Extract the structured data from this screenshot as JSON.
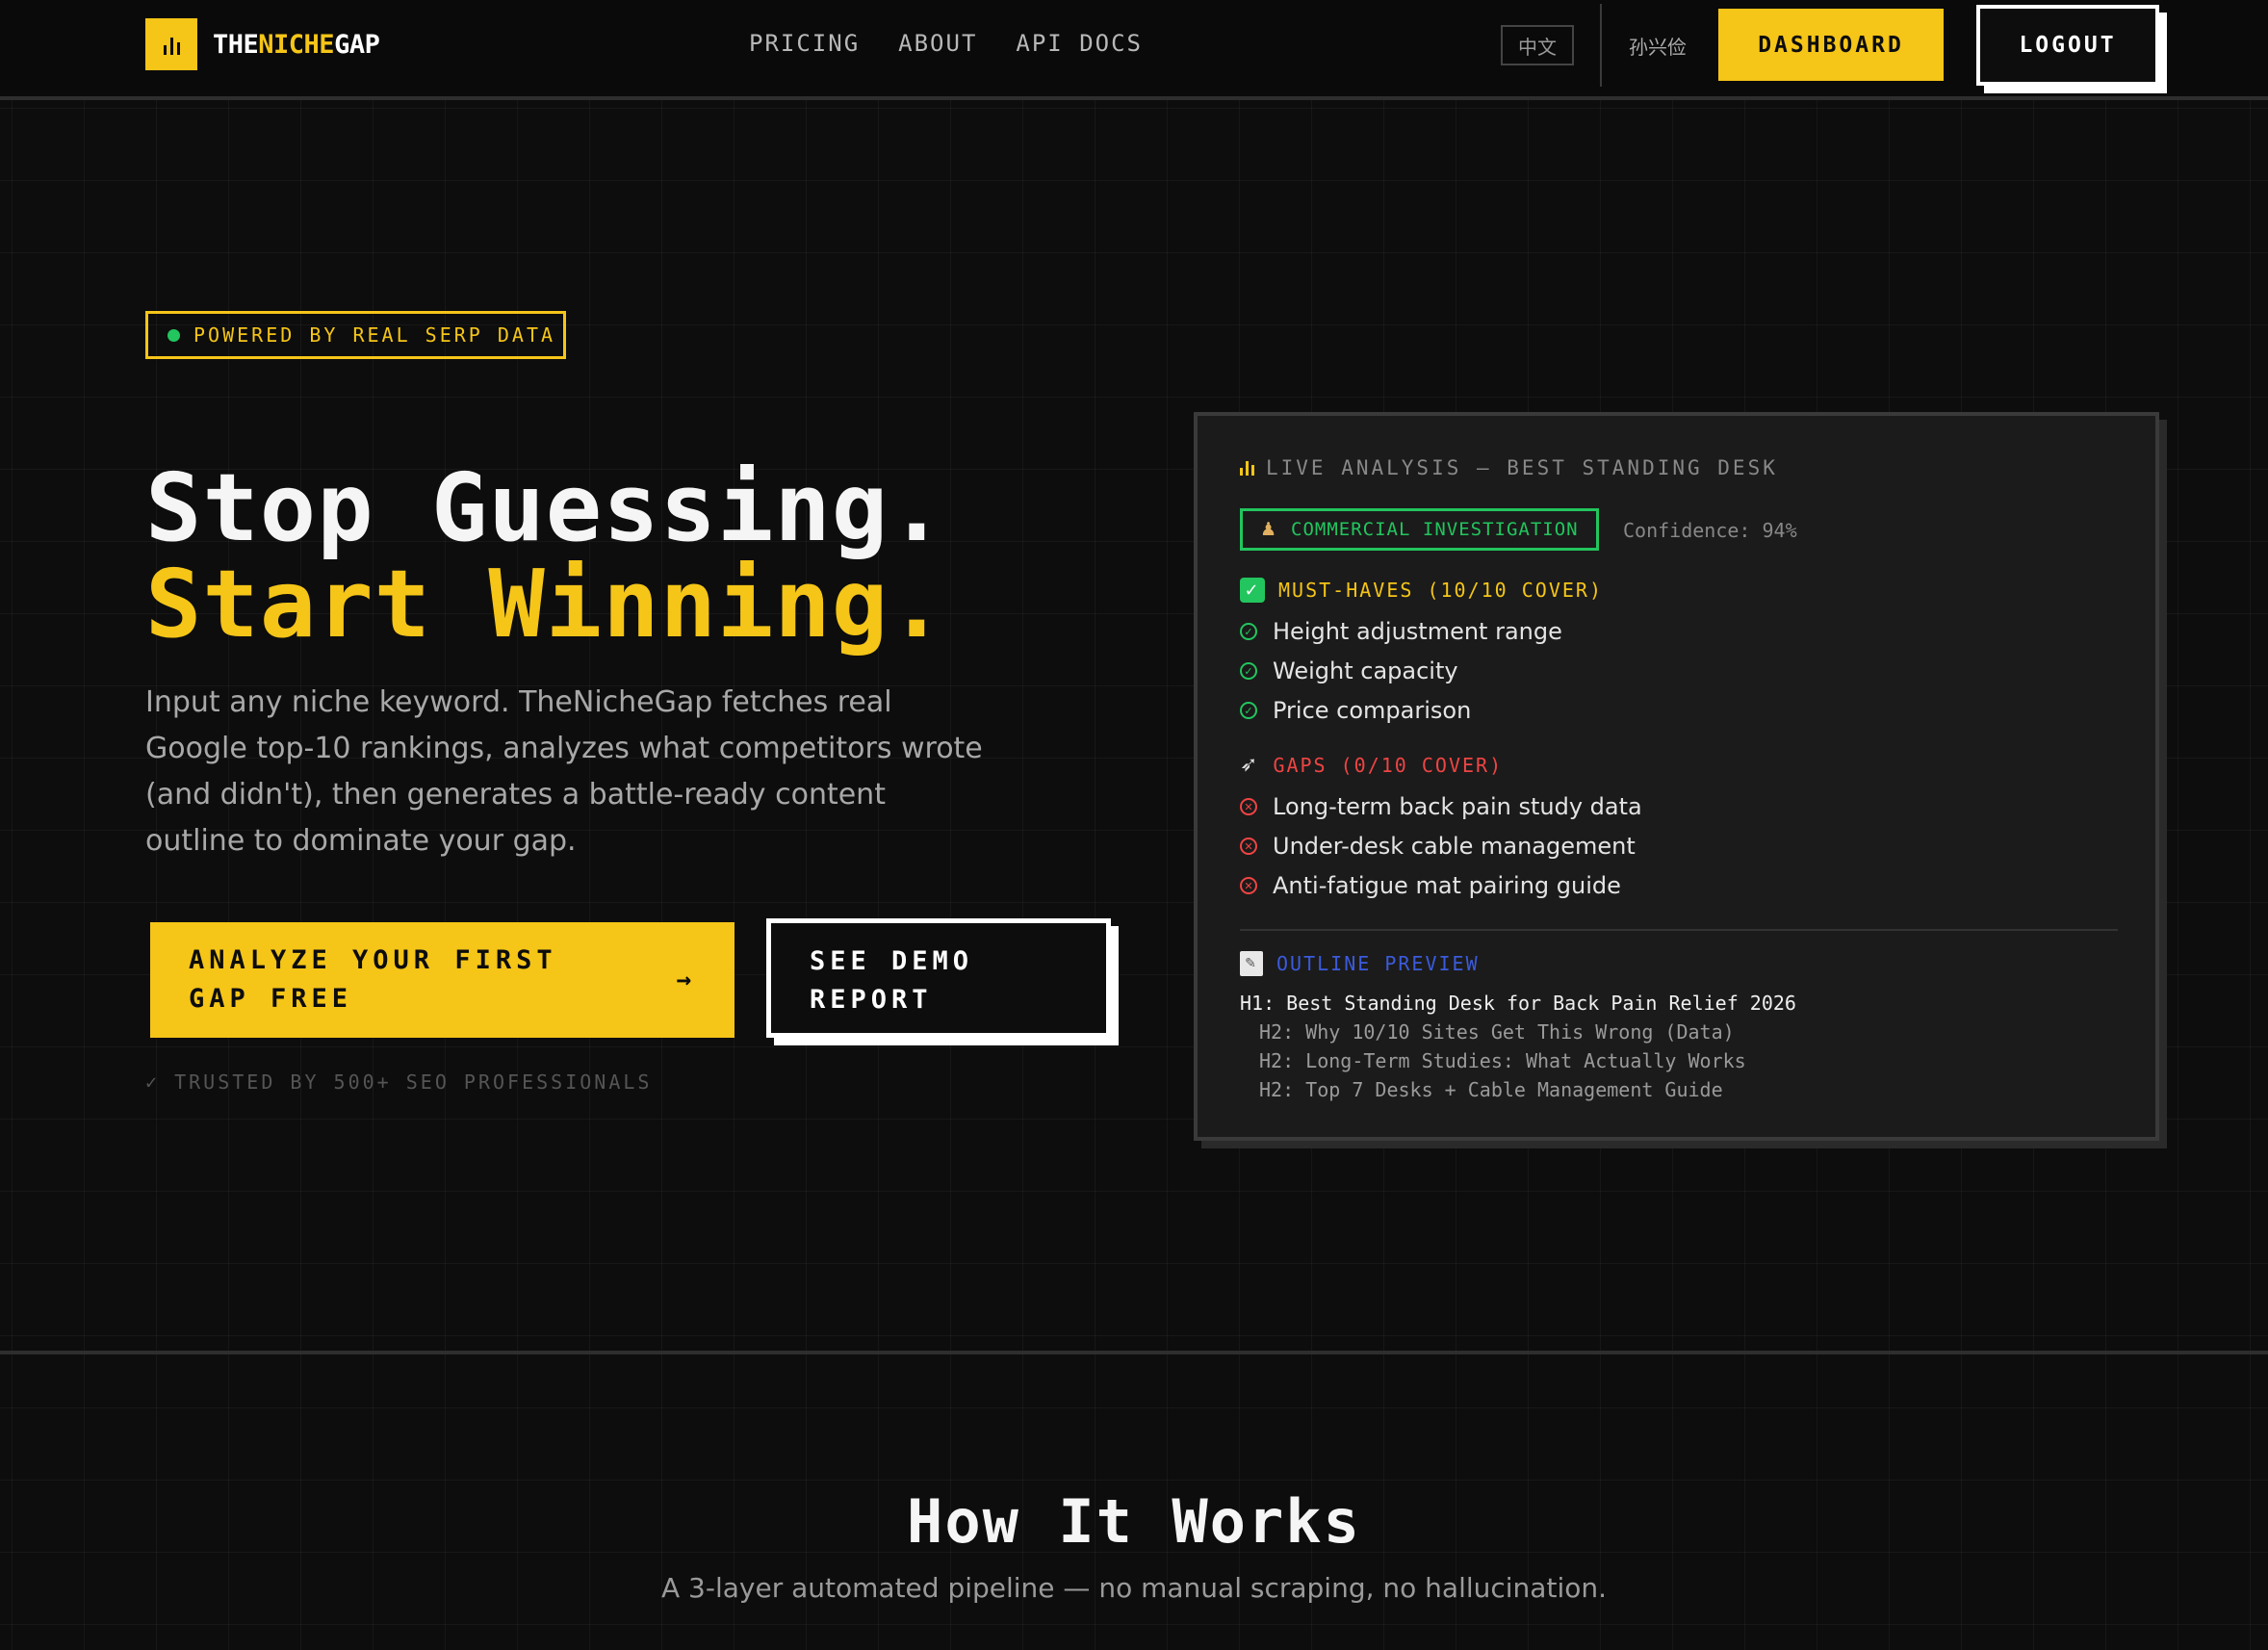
{
  "nav": {
    "logo_part1": "THE",
    "logo_part2": "NICHE",
    "logo_part3": "GAP",
    "links": [
      {
        "label": "PRICING"
      },
      {
        "label": "ABOUT"
      },
      {
        "label": "API DOCS"
      }
    ],
    "lang_label": "中文",
    "username": "孙兴俭",
    "dashboard_label": "DASHBOARD",
    "logout_label": "LOGOUT"
  },
  "hero": {
    "badge": "POWERED BY REAL SERP DATA",
    "title_line1": "Stop Guessing.",
    "title_line2": "Start Winning.",
    "description": "Input any niche keyword. TheNicheGap fetches real Google top-10 rankings, analyzes what competitors wrote (and didn't), then generates a battle-ready content outline to dominate your gap.",
    "cta_primary": "ANALYZE YOUR FIRST GAP FREE",
    "cta_primary_arrow": "→",
    "cta_secondary": "SEE DEMO REPORT",
    "trusted": "✓ TRUSTED BY 500+ SEO PROFESSIONALS"
  },
  "analysis_card": {
    "header": "LIVE ANALYSIS — BEST STANDING DESK",
    "intent_icon": "detective-icon",
    "intent": "COMMERCIAL INVESTIGATION",
    "confidence": "Confidence: 94%",
    "must_haves_title": "MUST-HAVES (10/10 COVER)",
    "must_haves": [
      "Height adjustment range",
      "Weight capacity",
      "Price comparison"
    ],
    "gaps_title": "GAPS (0/10 COVER)",
    "gaps": [
      "Long-term back pain study data",
      "Under-desk cable management",
      "Anti-fatigue mat pairing guide"
    ],
    "outline_title": "OUTLINE PREVIEW",
    "outline": [
      "H1: Best Standing Desk for Back Pain Relief 2026",
      "H2: Why 10/10 Sites Get This Wrong (Data)",
      "H2: Long-Term Studies: What Actually Works",
      "H2: Top 7 Desks + Cable Management Guide"
    ]
  },
  "how_it_works": {
    "title": "How It Works",
    "subtitle": "A 3-layer automated pipeline — no manual scraping, no hallucination."
  },
  "colors": {
    "accent": "#f5c518",
    "background": "#0d0d0d",
    "success": "#22c55e",
    "danger": "#ef4444",
    "outline": "#3b5bdb"
  }
}
